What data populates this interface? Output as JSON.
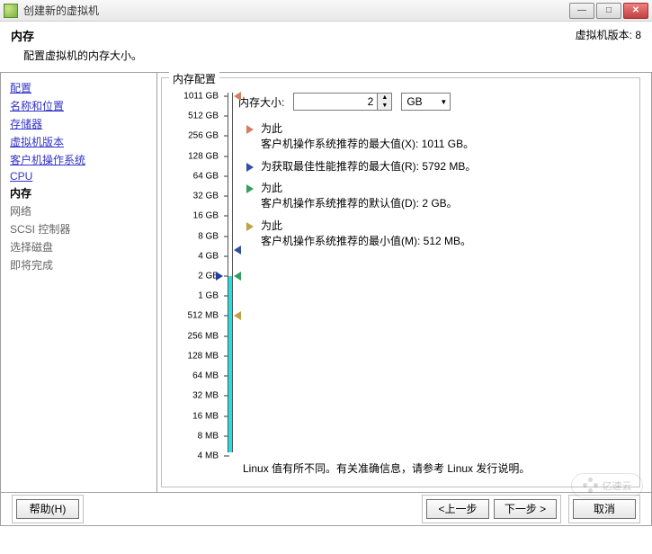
{
  "window": {
    "title": "创建新的虚拟机",
    "min": "—",
    "max": "□",
    "close": "✕"
  },
  "header": {
    "title": "内存",
    "subtitle": "配置虚拟机的内存大小。",
    "version": "虚拟机版本: 8"
  },
  "sidebar": {
    "items": [
      {
        "label": "配置",
        "type": "link"
      },
      {
        "label": "名称和位置",
        "type": "link"
      },
      {
        "label": "存储器",
        "type": "link"
      },
      {
        "label": "虚拟机版本",
        "type": "link"
      },
      {
        "label": "客户机操作系统",
        "type": "link"
      },
      {
        "label": "CPU",
        "type": "link"
      },
      {
        "label": "内存",
        "type": "current"
      },
      {
        "label": "网络",
        "type": "disabled"
      },
      {
        "label": "SCSI 控制器",
        "type": "disabled"
      },
      {
        "label": "选择磁盘",
        "type": "disabled"
      },
      {
        "label": "即将完成",
        "type": "disabled"
      }
    ]
  },
  "panel": {
    "legend": "内存配置",
    "size_label": "内存大小:",
    "size_value": "2",
    "unit": "GB",
    "scale_ticks": [
      "1011 GB",
      "512 GB",
      "256 GB",
      "128 GB",
      "64 GB",
      "32 GB",
      "16 GB",
      "8 GB",
      "4 GB",
      "2 GB",
      "1 GB",
      "512 MB",
      "256 MB",
      "128 MB",
      "64 MB",
      "32 MB",
      "16 MB",
      "8 MB",
      "4 MB"
    ],
    "selected_tick_index": 9,
    "markers": [
      {
        "prefix": "为此",
        "text": "客户机操作系统推荐的最大值(X): 1011 GB。",
        "color": "#d08060"
      },
      {
        "prefix": "",
        "text": "为获取最佳性能推荐的最大值(R): 5792 MB。",
        "color": "#3050a0"
      },
      {
        "prefix": "为此",
        "text": "客户机操作系统推荐的默认值(D): 2 GB。",
        "color": "#30a060"
      },
      {
        "prefix": "为此",
        "text": "客户机操作系统推荐的最小值(M): 512 MB。",
        "color": "#c0a040"
      }
    ],
    "note": "Linux 值有所不同。有关准确信息，请参考 Linux 发行说明。"
  },
  "footer": {
    "help": "帮助(H)",
    "back": "<上一步",
    "next": "下一步 >",
    "cancel": "取消"
  },
  "watermark": "亿速云"
}
